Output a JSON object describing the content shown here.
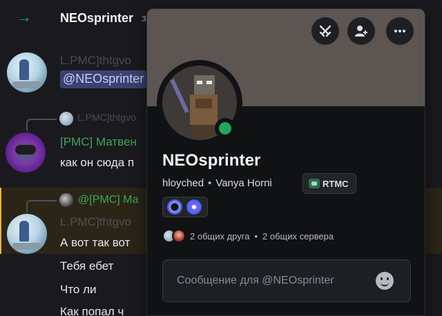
{
  "chat": {
    "join_name": "NEOsprinter",
    "join_suffix": "з",
    "message1_dim_author": "L.PMC]thtgvo",
    "mention": "@NEOsprinter",
    "reply1_dim": "L.PMC]thtgvo",
    "message2_author": "[PMC] Матвен",
    "message2_text": "как он сюда п",
    "reply2_author": "@[PMC] Ма",
    "message3_dim_author": "L.PMC]thtgvo",
    "lines": [
      "А вот так вот",
      "Тебя ебет",
      "Что ли",
      "Как попал ч"
    ]
  },
  "profile": {
    "display_name": "NEOsprinter",
    "username": "hloyched",
    "pronouns": "Vanya Horni",
    "clan_tag": "RTMC",
    "mutual_friends": "2 общих друга",
    "mutual_servers": "2 общих сервера",
    "message_placeholder": "Сообщение для @NEOsprinter",
    "status": "online",
    "status_color": "#23a55a"
  },
  "icons": {
    "join": "arrow-right-icon",
    "actions": [
      "crossed-swords-icon",
      "add-friend-icon",
      "more-icon"
    ],
    "emoji": "smiley-icon"
  }
}
